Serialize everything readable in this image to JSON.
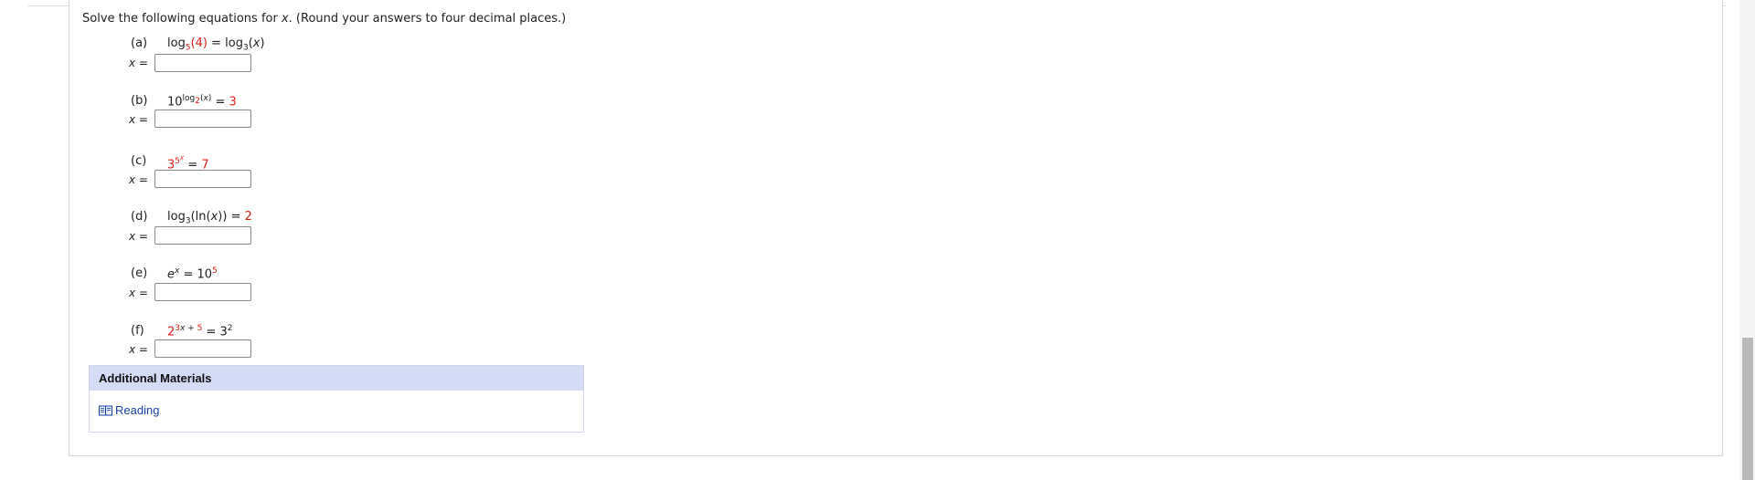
{
  "instructions": {
    "prefix": "Solve the following equations for ",
    "var": "x",
    "suffix": ". (Round your answers to four decimal places.)"
  },
  "answer_prefix": {
    "var": "x",
    "eq": " ="
  },
  "parts": [
    {
      "label": "(a)",
      "answer": ""
    },
    {
      "label": "(b)",
      "answer": ""
    },
    {
      "label": "(c)",
      "answer": ""
    },
    {
      "label": "(d)",
      "answer": ""
    },
    {
      "label": "(e)",
      "answer": ""
    },
    {
      "label": "(f)",
      "answer": ""
    }
  ],
  "equations": {
    "a": {
      "log": "log",
      "base1": "5",
      "arg1": "(4)",
      "eq": " = ",
      "log2": "log",
      "base2": "3",
      "arg2_open": "(",
      "arg2_var": "x",
      "arg2_close": ")"
    },
    "b": {
      "base": "10",
      "sup_log": "log",
      "sup_sub": "2",
      "sup_arg_open": "(",
      "sup_arg_var": "x",
      "sup_arg_close": ")",
      "eq": " = ",
      "rhs": "3"
    },
    "c": {
      "base": "3",
      "exp": "5",
      "exp_var": "x",
      "eq": " = ",
      "rhs": "7"
    },
    "d": {
      "log": "log",
      "base": "3",
      "arg_open": "(ln(",
      "arg_var": "x",
      "arg_close": "))",
      "eq": " = ",
      "rhs": "2"
    },
    "e": {
      "base": "e",
      "exp": "x",
      "eq": " = ",
      "rhs_base": "10",
      "rhs_exp": "5"
    },
    "f": {
      "base": "2",
      "exp_lhs": "3",
      "exp_var": "x",
      "exp_plus": " + ",
      "exp_const": "5",
      "eq": " = ",
      "rhs_base": "3",
      "rhs_exp": "2"
    }
  },
  "materials": {
    "title": "Additional Materials",
    "link_label": "Reading",
    "icon": "book-icon"
  },
  "colors": {
    "accent_red": "#e0201b",
    "header_bg": "#d3dbf5",
    "link": "#1a3fa8"
  }
}
